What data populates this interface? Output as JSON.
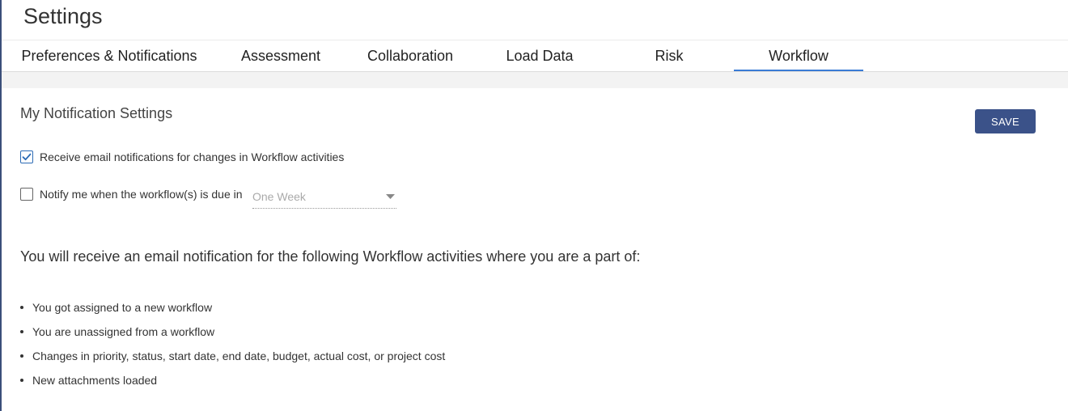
{
  "page": {
    "title": "Settings"
  },
  "tabs": [
    {
      "label": "Preferences & Notifications",
      "active": false
    },
    {
      "label": "Assessment",
      "active": false
    },
    {
      "label": "Collaboration",
      "active": false
    },
    {
      "label": "Load Data",
      "active": false
    },
    {
      "label": "Risk",
      "active": false
    },
    {
      "label": "Workflow",
      "active": true
    }
  ],
  "settings": {
    "section_title": "My Notification Settings",
    "save_label": "SAVE",
    "email_changes": {
      "label": "Receive email notifications for changes in Workflow activities",
      "checked": true
    },
    "due_notify": {
      "label": "Notify me when the workflow(s) is due in",
      "checked": false
    },
    "due_period": {
      "value": "One Week"
    }
  },
  "info": {
    "heading": "You will receive an email notification for the following Workflow activities where you are a part of:",
    "items": [
      "You got assigned to a new workflow",
      "You are unassigned from a workflow",
      "Changes in priority, status, start date, end date, budget, actual cost, or project cost",
      "New attachments loaded"
    ]
  },
  "colors": {
    "accent": "#3a7bd5",
    "button": "#3b5289",
    "checkbox_checked": "#2c6bb5"
  },
  "icons": {
    "checked": "check-icon",
    "dropdown": "caret-down-icon"
  }
}
